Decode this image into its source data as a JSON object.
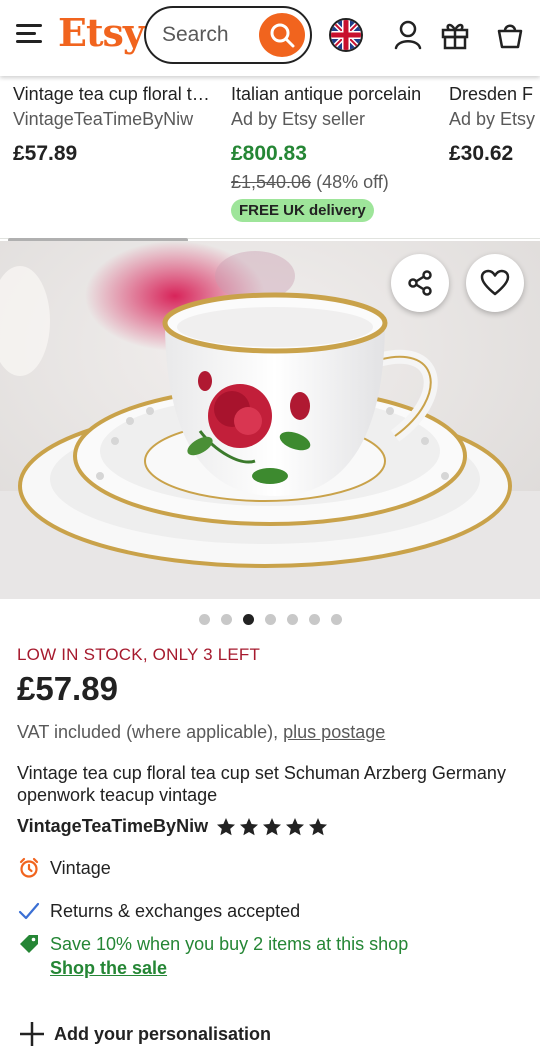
{
  "header": {
    "logo": "Etsy",
    "search_placeholder": "Search"
  },
  "recommended": [
    {
      "title": "Vintage tea cup floral tea cup set",
      "subtitle": "VintageTeaTimeByNiw",
      "price": "£57.89"
    },
    {
      "title": "Italian antique porcelain",
      "subtitle": "Ad by Etsy seller",
      "price": "£800.83",
      "original_price": "£1,540.06",
      "discount": "(48% off)",
      "badge": "FREE UK delivery"
    },
    {
      "title": "Dresden F",
      "subtitle": "Ad by Etsy",
      "price": "£30.62"
    }
  ],
  "gallery": {
    "dot_count": 7,
    "active_dot": 3
  },
  "listing": {
    "stock": "LOW IN STOCK, ONLY 3 LEFT",
    "price": "£57.89",
    "vat": "VAT included (where applicable),",
    "postage_link": "plus postage",
    "title": "Vintage tea cup floral tea cup set Schuman Arzberg Germany openwork teacup vintage",
    "shop_name": "VintageTeaTimeByNiw",
    "rating": 5
  },
  "features": {
    "vintage": "Vintage",
    "returns": "Returns & exchanges accepted",
    "promo": "Save 10% when you buy 2 items at this shop",
    "shop_sale": "Shop the sale"
  },
  "personalisation": "Add your personalisation",
  "colors": {
    "brand": "#F1641E",
    "sale_green": "#258635",
    "stock_red": "#A61A2E",
    "badge_green": "#9EE59A"
  }
}
